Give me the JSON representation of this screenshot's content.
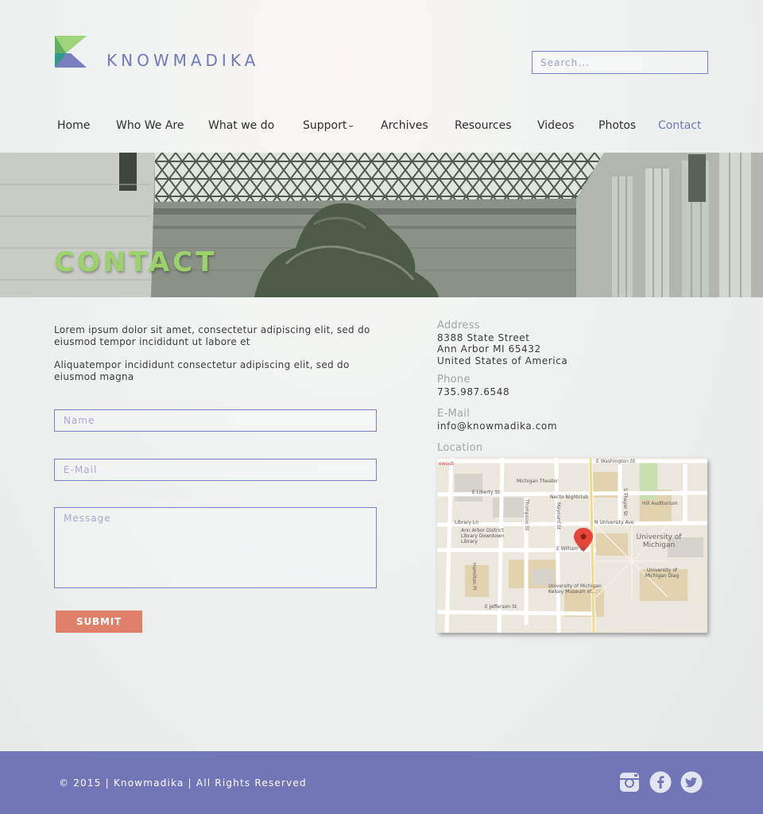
{
  "brand": {
    "name": "KNOWMADIKA"
  },
  "search": {
    "placeholder": "Search..."
  },
  "nav": {
    "items": [
      "Home",
      "Who We Are",
      "What we do",
      "Support",
      "Archives",
      "Resources",
      "Videos",
      "Photos",
      "Contact"
    ],
    "active": "Contact",
    "dropdown_icon": "chevron-down-icon"
  },
  "hero": {
    "title": "CONTACT"
  },
  "intro": {
    "p1": "Lorem ipsum dolor sit amet, consectetur adipiscing elit, sed do eiusmod tempor incididunt ut labore et",
    "p2": "Aliquatempor incididunt consectetur adipiscing elit, sed do eiusmod magna"
  },
  "form": {
    "name_placeholder": "Name",
    "email_placeholder": "E-Mail",
    "message_placeholder": "Message",
    "submit_label": "SUBMIT"
  },
  "contact": {
    "address_label": "Address",
    "address_lines": [
      "8388 State Street",
      "Ann Arbor MI 65432",
      "United States of America"
    ],
    "phone_label": "Phone",
    "phone": "735.987.6548",
    "email_label": "E-Mail",
    "email": "info@knowmadika.com",
    "location_label": "Location"
  },
  "map": {
    "labels": {
      "washington": "E Washington St",
      "liberty": "E Liberty St",
      "michigan_theater": "Michigan Theater",
      "necto": "Necto Nightclub",
      "thayer": "S Thayer St",
      "hill": "Hill Auditorium",
      "library_ln": "Library Ln",
      "university": "N University Ave",
      "aadl": "Ann Arbor District Library Downtown Library",
      "thompson": "Thompson St",
      "maynard": "Maynard St",
      "william": "E William St",
      "umich": "University of Michigan",
      "umich_diag": "University of Michigan Diag",
      "hamilton": "Hamilton Pl",
      "kelsey": "University of Michigan Kelsey Museum of...",
      "jefferson": "E Jefferson St",
      "corner": "ewsub"
    }
  },
  "footer": {
    "copyright": "© 2015 | Knowmadika | All Rights Reserved"
  },
  "colors": {
    "accent": "#7278b8",
    "hero_title": "#9bd36a",
    "submit": "#e07f6a",
    "footer": "#7276b7"
  }
}
